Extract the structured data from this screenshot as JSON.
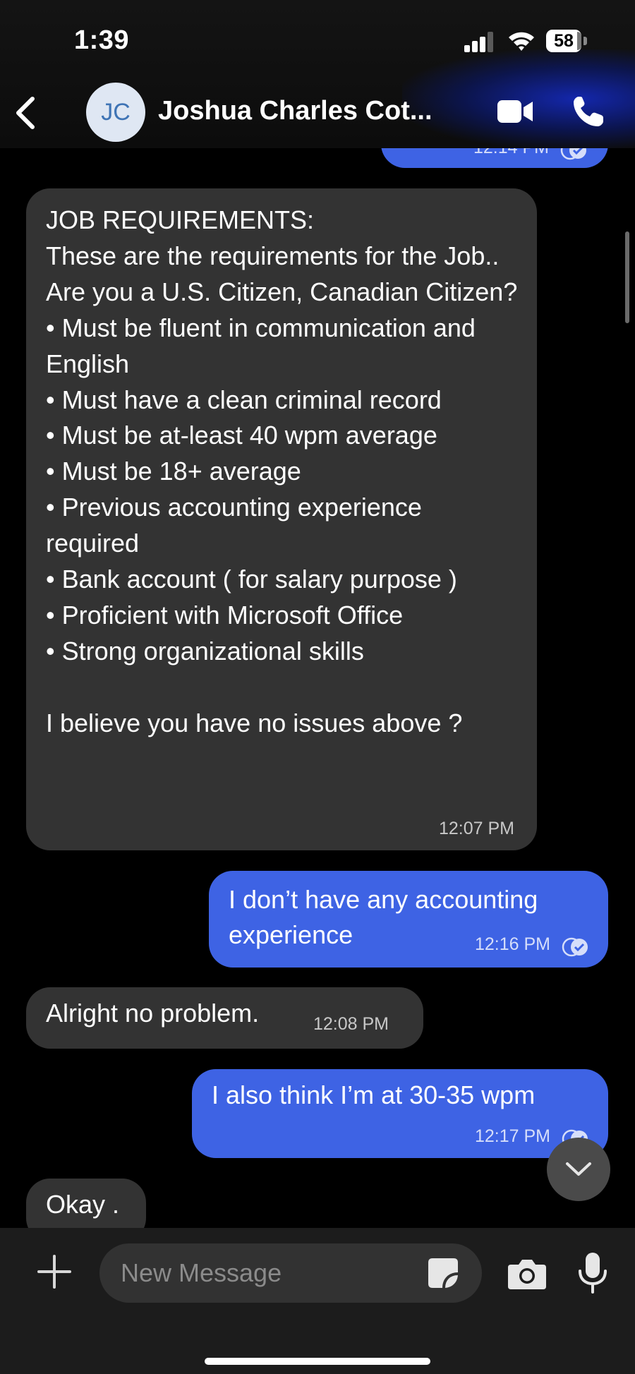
{
  "status_bar": {
    "time": "1:39",
    "battery": "58"
  },
  "header": {
    "avatar_initials": "JC",
    "contact_name": "Joshua Charles Cot..."
  },
  "messages": [
    {
      "direction": "outgoing",
      "text": "",
      "time": "12:14 PM"
    },
    {
      "direction": "incoming",
      "text": "JOB REQUIREMENTS:\nThese are the requirements for the Job..\nAre you a U.S. Citizen, Canadian Citizen?\n• Must be fluent in communication and English\n• Must have a clean criminal record\n• Must be at-least 40 wpm average\n• Must be 18+ average\n• Previous accounting experience required\n• Bank account ( for salary purpose )\n• Proficient with Microsoft Office\n• Strong organizational skills\n\nI believe you have no issues above ?",
      "time": "12:07 PM"
    },
    {
      "direction": "outgoing",
      "text": "I don’t have any accounting experience",
      "time": "12:16 PM"
    },
    {
      "direction": "incoming",
      "text": "Alright no problem.",
      "time": "12:08 PM"
    },
    {
      "direction": "outgoing",
      "text": "I also think I’m at 30-35 wpm",
      "time": "12:17 PM"
    },
    {
      "direction": "incoming",
      "text": "Okay .",
      "time": ""
    }
  ],
  "composer": {
    "placeholder": "New Message"
  },
  "colors": {
    "outgoing_bubble": "#3e63e4",
    "incoming_bubble": "#333333",
    "background": "#000000"
  },
  "icons": [
    "back-icon",
    "video-call-icon",
    "phone-icon",
    "plus-icon",
    "sticker-icon",
    "camera-icon",
    "microphone-icon",
    "chevron-down-icon",
    "read-check-icon"
  ]
}
